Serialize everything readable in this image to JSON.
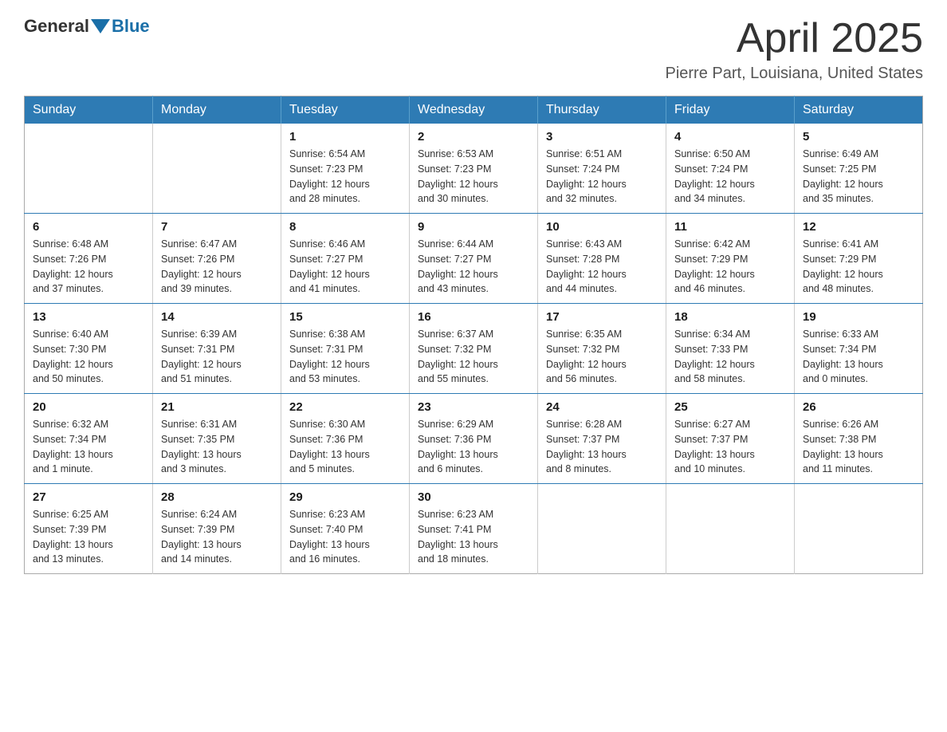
{
  "header": {
    "logo_general": "General",
    "logo_blue": "Blue",
    "month_title": "April 2025",
    "location": "Pierre Part, Louisiana, United States"
  },
  "days_of_week": [
    "Sunday",
    "Monday",
    "Tuesday",
    "Wednesday",
    "Thursday",
    "Friday",
    "Saturday"
  ],
  "weeks": [
    [
      {
        "day": "",
        "info": ""
      },
      {
        "day": "",
        "info": ""
      },
      {
        "day": "1",
        "info": "Sunrise: 6:54 AM\nSunset: 7:23 PM\nDaylight: 12 hours\nand 28 minutes."
      },
      {
        "day": "2",
        "info": "Sunrise: 6:53 AM\nSunset: 7:23 PM\nDaylight: 12 hours\nand 30 minutes."
      },
      {
        "day": "3",
        "info": "Sunrise: 6:51 AM\nSunset: 7:24 PM\nDaylight: 12 hours\nand 32 minutes."
      },
      {
        "day": "4",
        "info": "Sunrise: 6:50 AM\nSunset: 7:24 PM\nDaylight: 12 hours\nand 34 minutes."
      },
      {
        "day": "5",
        "info": "Sunrise: 6:49 AM\nSunset: 7:25 PM\nDaylight: 12 hours\nand 35 minutes."
      }
    ],
    [
      {
        "day": "6",
        "info": "Sunrise: 6:48 AM\nSunset: 7:26 PM\nDaylight: 12 hours\nand 37 minutes."
      },
      {
        "day": "7",
        "info": "Sunrise: 6:47 AM\nSunset: 7:26 PM\nDaylight: 12 hours\nand 39 minutes."
      },
      {
        "day": "8",
        "info": "Sunrise: 6:46 AM\nSunset: 7:27 PM\nDaylight: 12 hours\nand 41 minutes."
      },
      {
        "day": "9",
        "info": "Sunrise: 6:44 AM\nSunset: 7:27 PM\nDaylight: 12 hours\nand 43 minutes."
      },
      {
        "day": "10",
        "info": "Sunrise: 6:43 AM\nSunset: 7:28 PM\nDaylight: 12 hours\nand 44 minutes."
      },
      {
        "day": "11",
        "info": "Sunrise: 6:42 AM\nSunset: 7:29 PM\nDaylight: 12 hours\nand 46 minutes."
      },
      {
        "day": "12",
        "info": "Sunrise: 6:41 AM\nSunset: 7:29 PM\nDaylight: 12 hours\nand 48 minutes."
      }
    ],
    [
      {
        "day": "13",
        "info": "Sunrise: 6:40 AM\nSunset: 7:30 PM\nDaylight: 12 hours\nand 50 minutes."
      },
      {
        "day": "14",
        "info": "Sunrise: 6:39 AM\nSunset: 7:31 PM\nDaylight: 12 hours\nand 51 minutes."
      },
      {
        "day": "15",
        "info": "Sunrise: 6:38 AM\nSunset: 7:31 PM\nDaylight: 12 hours\nand 53 minutes."
      },
      {
        "day": "16",
        "info": "Sunrise: 6:37 AM\nSunset: 7:32 PM\nDaylight: 12 hours\nand 55 minutes."
      },
      {
        "day": "17",
        "info": "Sunrise: 6:35 AM\nSunset: 7:32 PM\nDaylight: 12 hours\nand 56 minutes."
      },
      {
        "day": "18",
        "info": "Sunrise: 6:34 AM\nSunset: 7:33 PM\nDaylight: 12 hours\nand 58 minutes."
      },
      {
        "day": "19",
        "info": "Sunrise: 6:33 AM\nSunset: 7:34 PM\nDaylight: 13 hours\nand 0 minutes."
      }
    ],
    [
      {
        "day": "20",
        "info": "Sunrise: 6:32 AM\nSunset: 7:34 PM\nDaylight: 13 hours\nand 1 minute."
      },
      {
        "day": "21",
        "info": "Sunrise: 6:31 AM\nSunset: 7:35 PM\nDaylight: 13 hours\nand 3 minutes."
      },
      {
        "day": "22",
        "info": "Sunrise: 6:30 AM\nSunset: 7:36 PM\nDaylight: 13 hours\nand 5 minutes."
      },
      {
        "day": "23",
        "info": "Sunrise: 6:29 AM\nSunset: 7:36 PM\nDaylight: 13 hours\nand 6 minutes."
      },
      {
        "day": "24",
        "info": "Sunrise: 6:28 AM\nSunset: 7:37 PM\nDaylight: 13 hours\nand 8 minutes."
      },
      {
        "day": "25",
        "info": "Sunrise: 6:27 AM\nSunset: 7:37 PM\nDaylight: 13 hours\nand 10 minutes."
      },
      {
        "day": "26",
        "info": "Sunrise: 6:26 AM\nSunset: 7:38 PM\nDaylight: 13 hours\nand 11 minutes."
      }
    ],
    [
      {
        "day": "27",
        "info": "Sunrise: 6:25 AM\nSunset: 7:39 PM\nDaylight: 13 hours\nand 13 minutes."
      },
      {
        "day": "28",
        "info": "Sunrise: 6:24 AM\nSunset: 7:39 PM\nDaylight: 13 hours\nand 14 minutes."
      },
      {
        "day": "29",
        "info": "Sunrise: 6:23 AM\nSunset: 7:40 PM\nDaylight: 13 hours\nand 16 minutes."
      },
      {
        "day": "30",
        "info": "Sunrise: 6:23 AM\nSunset: 7:41 PM\nDaylight: 13 hours\nand 18 minutes."
      },
      {
        "day": "",
        "info": ""
      },
      {
        "day": "",
        "info": ""
      },
      {
        "day": "",
        "info": ""
      }
    ]
  ]
}
